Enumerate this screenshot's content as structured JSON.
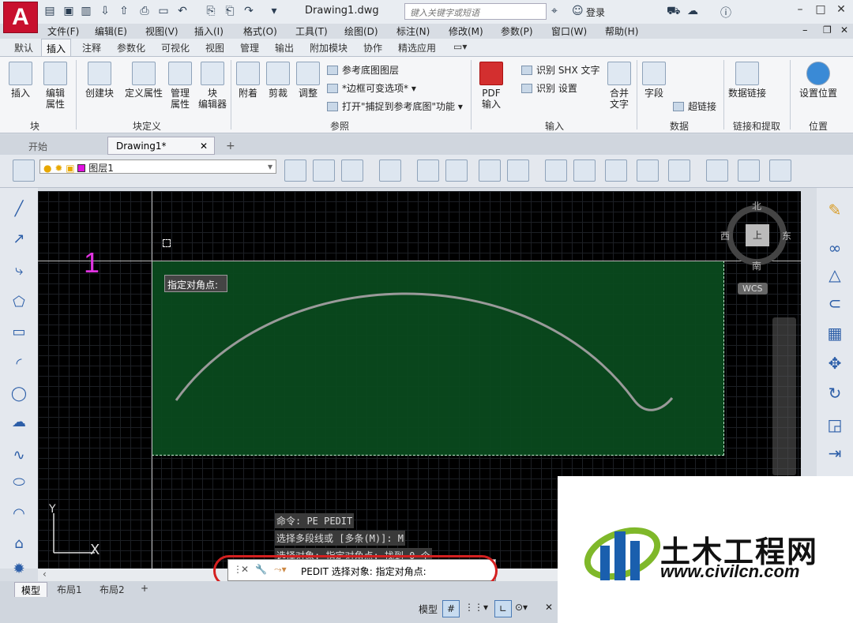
{
  "window": {
    "doc_title": "Drawing1.dwg",
    "search_placeholder": "键入关键字或短语",
    "login": "登录",
    "help": "?"
  },
  "menu": [
    "文件(F)",
    "编辑(E)",
    "视图(V)",
    "插入(I)",
    "格式(O)",
    "工具(T)",
    "绘图(D)",
    "标注(N)",
    "修改(M)",
    "参数(P)",
    "窗口(W)",
    "帮助(H)"
  ],
  "ribbon_tabs": [
    "默认",
    "插入",
    "注释",
    "参数化",
    "可视化",
    "视图",
    "管理",
    "输出",
    "附加模块",
    "协作",
    "精选应用"
  ],
  "ribbon": {
    "block": {
      "insert": "插入",
      "edit_attr1": "编辑",
      "edit_attr2": "属性",
      "panel": "块"
    },
    "blockdef": {
      "create": "创建块",
      "define_attr": "定义属性",
      "manage1": "管理",
      "manage2": "属性",
      "editor1": "块",
      "editor2": "编辑器",
      "panel": "块定义"
    },
    "ref": {
      "attach": "附着",
      "clip": "剪裁",
      "adjust": "调整",
      "underlay_layers": "参考底图图层",
      "frame": "*边框可变选项*",
      "snap": "打开\"捕捉到参考底图\"功能",
      "panel": "参照"
    },
    "import": {
      "pdf1": "PDF",
      "pdf2": "输入",
      "shx": "识别 SHX 文字",
      "settings": "识别 设置",
      "merge1": "合并",
      "merge2": "文字",
      "panel": "输入"
    },
    "data": {
      "field": "字段",
      "hyperlink": "超链接",
      "panel": "数据"
    },
    "link": {
      "datalink": "数据链接",
      "panel": "链接和提取"
    },
    "location": {
      "set": "设置位置",
      "panel": "位置"
    }
  },
  "file_tabs": [
    "开始",
    "Drawing1*"
  ],
  "layer": {
    "name": "图层1"
  },
  "canvas": {
    "tooltip": "指定对角点:",
    "marker": "1",
    "ucs_y": "Y",
    "ucs_x": "X",
    "compass": {
      "n": "北",
      "s": "南",
      "w": "西",
      "e": "东",
      "top": "上",
      "wcs": "WCS"
    }
  },
  "command_history": [
    "命令: PE PEDIT",
    "选择多段线或 [多条(M)]: M",
    "选择对象: 指定对角点: 找到 0 个"
  ],
  "command_line": "PEDIT 选择对象: 指定对角点:",
  "layout_tabs": [
    "模型",
    "布局1",
    "布局2"
  ],
  "status": {
    "model": "模型"
  },
  "watermark": {
    "title": "土木工程网",
    "url": "www.civilcn.com"
  },
  "colors": {
    "selection_fill": "#0a4a1e",
    "highlight_oval": "#d42020",
    "marker": "#e033e0"
  }
}
